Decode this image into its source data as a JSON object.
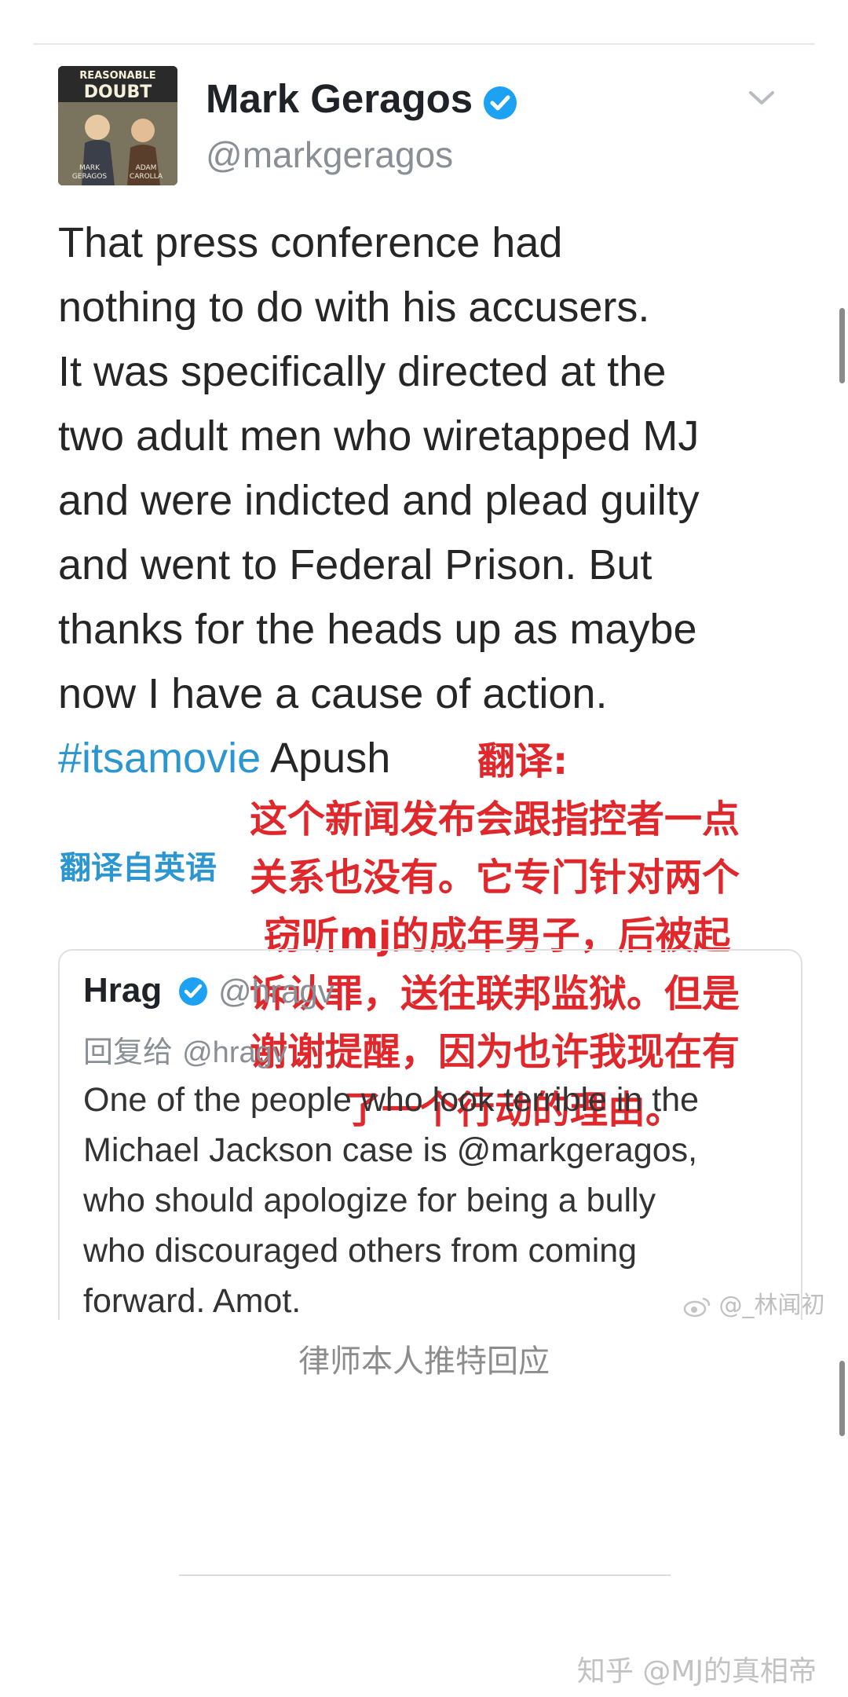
{
  "tweet": {
    "author_name": "Mark Geragos",
    "handle": "@markgeragos",
    "avatar_text": [
      "REASONABLE",
      "DOUBT",
      "MARK",
      "GERAGOS",
      "ADAM",
      "CAROLLA"
    ],
    "body_lines": [
      "That press conference had",
      "nothing to do with his accusers.",
      "It was specifically directed at the",
      "two adult men who wiretapped MJ",
      "and were indicted and plead guilty",
      "and went to Federal Prison. But",
      "thanks for the heads up as maybe",
      "now I have a cause of action."
    ],
    "hashtag": "#itsamovie",
    "hashtag_suffix": " Apush",
    "translate_link": "翻译自英语"
  },
  "translation_overlay": {
    "lines": [
      "翻译:",
      "这个新闻发布会跟指控者一点",
      "关系也没有。它专门针对两个",
      "窃听mj的成年男子，后被起",
      "诉认罪，送往联邦监狱。但是",
      "谢谢提醒，因为也许我现在有",
      "了一个行动的理由。"
    ]
  },
  "quoted_tweet": {
    "author_name": "Hrag",
    "handle": "@hragv",
    "reply_label": "回复给",
    "reply_handle": "@hragv",
    "text_lines": [
      "One of the people who look terrible in the",
      "Michael Jackson case is @markgeragos,",
      "who should apologize for being a bully",
      "who discouraged others from coming",
      "forward. Amot."
    ]
  },
  "watermark": "@_林闻初",
  "caption": "律师本人推特回应",
  "footer": "知乎 @MJ的真相帝",
  "colors": {
    "link_blue": "#2b96cf",
    "verified_blue": "#1da1f2",
    "translation_red": "#e0282c"
  },
  "icons": [
    "verified-badge-icon",
    "chevron-down-icon",
    "weibo-icon"
  ]
}
